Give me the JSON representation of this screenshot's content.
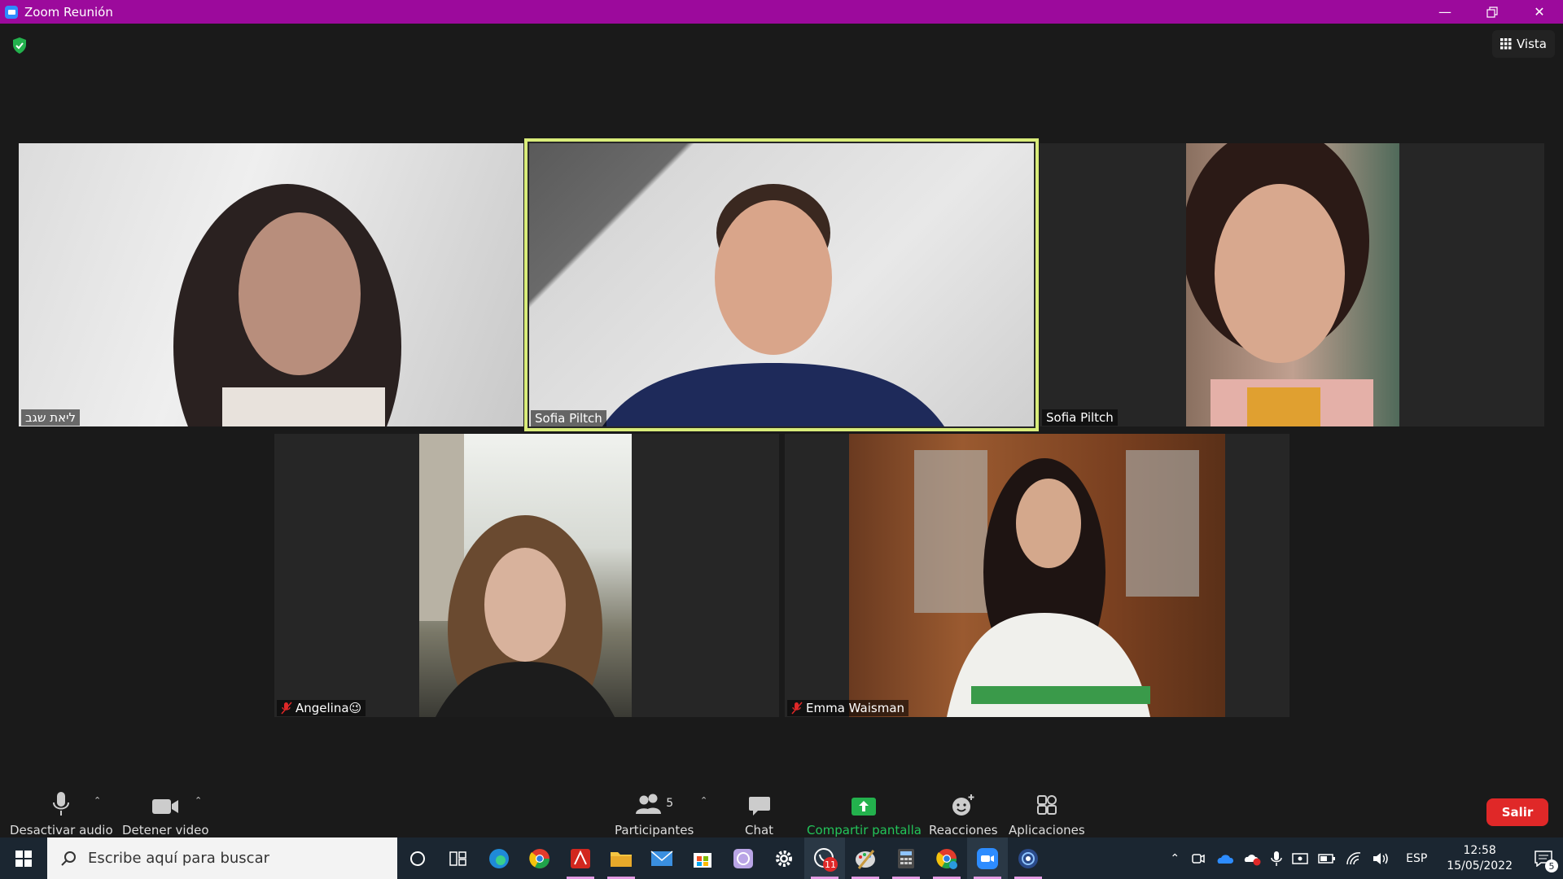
{
  "window": {
    "title": "Zoom Reunión"
  },
  "header": {
    "view_label": "Vista"
  },
  "participants": [
    {
      "name": "ליאת שגב",
      "muted": false,
      "active": false
    },
    {
      "name": "Sofia Piltch",
      "muted": false,
      "active": true
    },
    {
      "name": "Sofia Piltch",
      "muted": false,
      "active": false
    },
    {
      "name": "Angelina😉",
      "muted": true,
      "active": false
    },
    {
      "name": "Emma Waisman",
      "muted": true,
      "active": false
    }
  ],
  "toolbar": {
    "mute_label": "Desactivar audio",
    "video_label": "Detener video",
    "participants_label": "Participantes",
    "participants_count": "5",
    "chat_label": "Chat",
    "share_label": "Compartir pantalla",
    "reactions_label": "Reacciones",
    "apps_label": "Aplicaciones",
    "leave_label": "Salir"
  },
  "taskbar": {
    "search_placeholder": "Escribe aquí para buscar",
    "whatsapp_badge": "11",
    "language": "ESP",
    "time": "12:58",
    "date": "15/05/2022",
    "notifications_count": "5"
  },
  "colors": {
    "titlebar": "#9c0a9c",
    "active_speaker": "#d9ec7a",
    "share_green": "#23b14d",
    "leave_red": "#e02828"
  }
}
